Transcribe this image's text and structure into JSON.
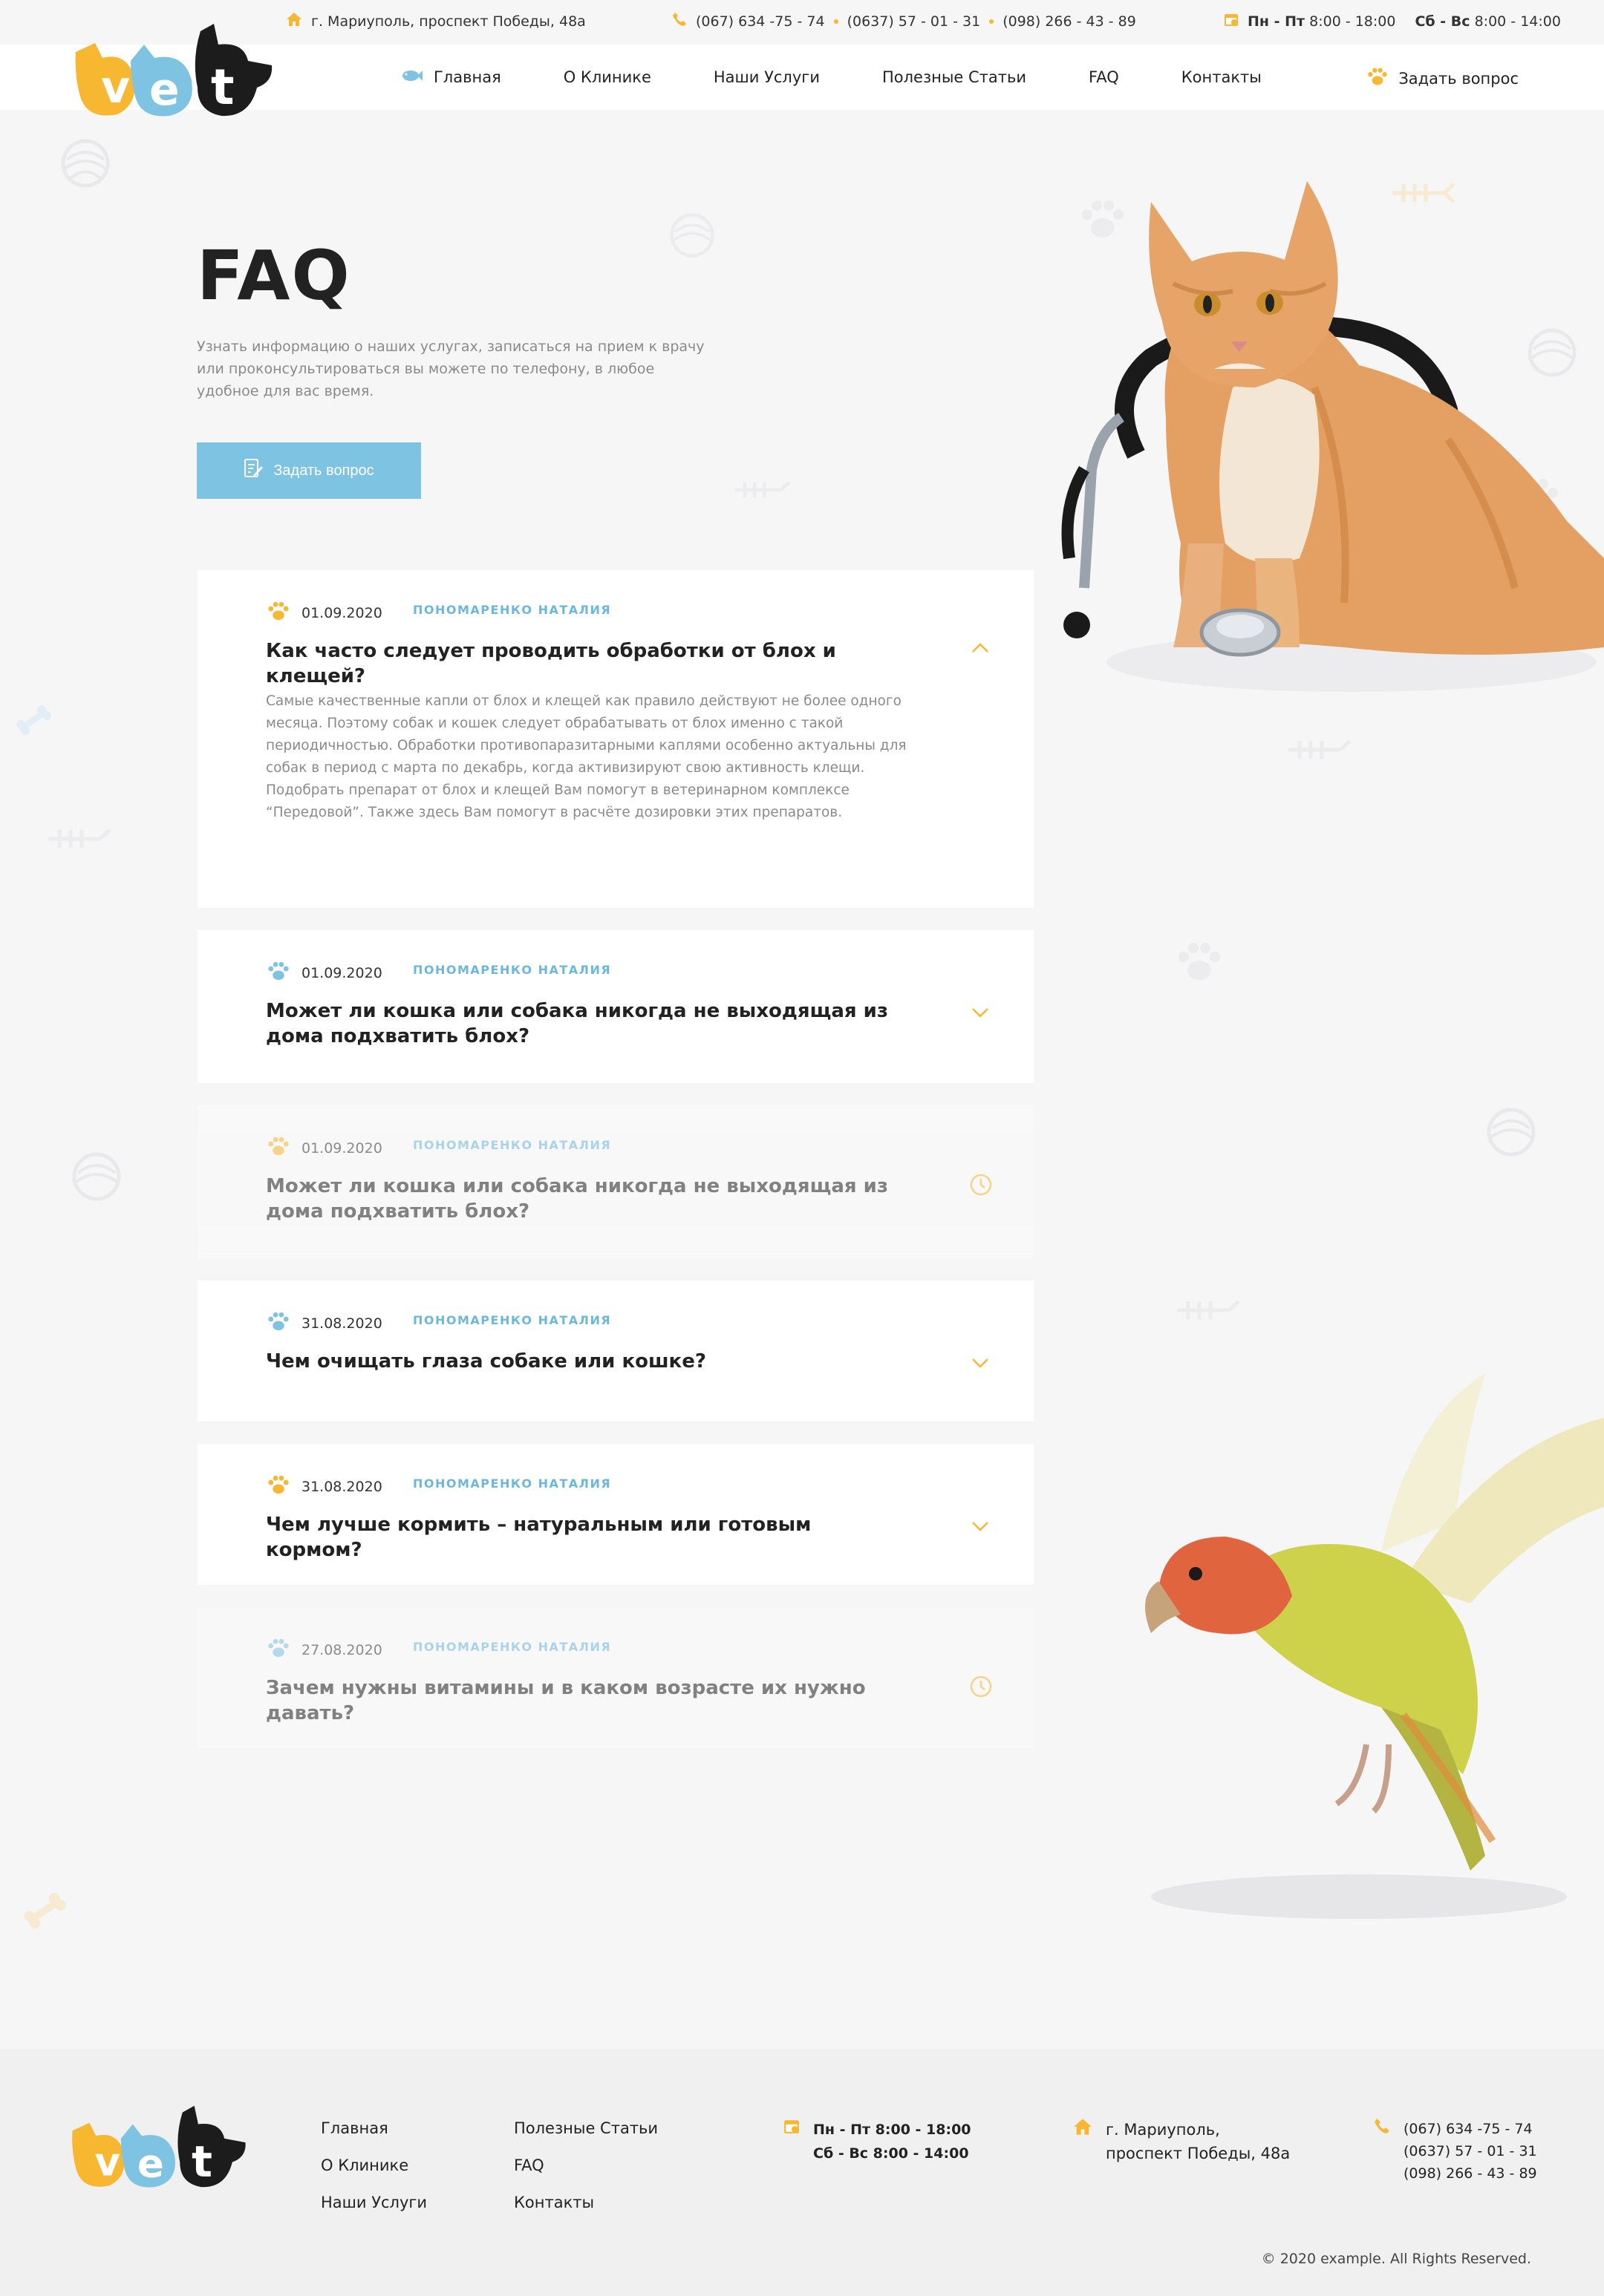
{
  "topbar": {
    "address": "г. Мариуполь, проспект Победы, 48а",
    "phones": [
      "(067) 634 -75 - 74",
      "(0637) 57 - 01 - 31",
      "(098) 266 - 43 - 89"
    ],
    "hours_weekday_label": "Пн - Пт",
    "hours_weekday": "8:00 - 18:00",
    "hours_weekend_label": "Сб - Вс",
    "hours_weekend": "8:00 - 14:00"
  },
  "nav": {
    "items": [
      "Главная",
      "О Клинике",
      "Наши Услуги",
      "Полезные Статьи",
      "FAQ",
      "Контакты"
    ],
    "ask": "Задать вопрос"
  },
  "hero": {
    "title": "FAQ",
    "description": "Узнать информацию о наших услугах, записаться на прием к врачу или проконсультироваться вы можете по телефону, в любое удобное для вас время.",
    "button": "Задать вопрос"
  },
  "faq": [
    {
      "date": "01.09.2020",
      "author": "ПОНОМАРЕНКО НАТАЛИЯ",
      "question": "Как часто следует проводить обработки от блох и клещей?",
      "answer": "Самые качественные капли от блох и клещей как правило действуют не более одного месяца. Поэтому собак и кошек следует обрабатывать от блох именно с такой периодичностью. Обработки противопаразитарными каплями особенно актуальны для собак в период с марта по декабрь, когда активизируют свою активность клещи. Подобрать препарат от блох и клещей Вам помогут в ветеринарном комплексе “Передовой”. Также здесь Вам помогут в расчёте дозировки этих препаратов.",
      "state": "open",
      "paw": "orange"
    },
    {
      "date": "01.09.2020",
      "author": "ПОНОМАРЕНКО НАТАЛИЯ",
      "question": "Может ли кошка или собака никогда не выходящая из дома подхватить блох?",
      "state": "closed",
      "paw": "blue"
    },
    {
      "date": "01.09.2020",
      "author": "ПОНОМАРЕНКО НАТАЛИЯ",
      "question": "Может ли кошка или собака никогда не выходящая из дома подхватить блох?",
      "state": "pending",
      "paw": "orange"
    },
    {
      "date": "31.08.2020",
      "author": "ПОНОМАРЕНКО НАТАЛИЯ",
      "question": "Чем очищать глаза собаке или кошке?",
      "state": "closed",
      "paw": "blue"
    },
    {
      "date": "31.08.2020",
      "author": "ПОНОМАРЕНКО НАТАЛИЯ",
      "question": "Чем лучше кормить – натуральным или готовым кормом?",
      "state": "closed",
      "paw": "orange"
    },
    {
      "date": "27.08.2020",
      "author": "ПОНОМАРЕНКО НАТАЛИЯ",
      "question": "Зачем нужны витамины и в каком возрасте их нужно давать?",
      "state": "pending",
      "paw": "blue"
    }
  ],
  "footer": {
    "links_col1": [
      "Главная",
      "О Клинике",
      "Наши Услуги"
    ],
    "links_col2": [
      "Полезные Статьи",
      "FAQ",
      "Контакты"
    ],
    "hours_weekday": "Пн - Пт 8:00 - 18:00",
    "hours_weekend": "Сб - Вс 8:00 - 14:00",
    "address_line1": "г. Мариуполь,",
    "address_line2": "проспект Победы, 48а",
    "phones": [
      "(067) 634 -75 - 74",
      "(0637) 57 - 01 - 31",
      "(098) 266 - 43 - 89"
    ],
    "copyright": "© 2020 example. All Rights Reserved."
  },
  "colors": {
    "accent_blue": "#7fc3e3",
    "accent_orange": "#f7b731",
    "text_dark": "#222222",
    "text_muted": "#8a8a8a"
  }
}
